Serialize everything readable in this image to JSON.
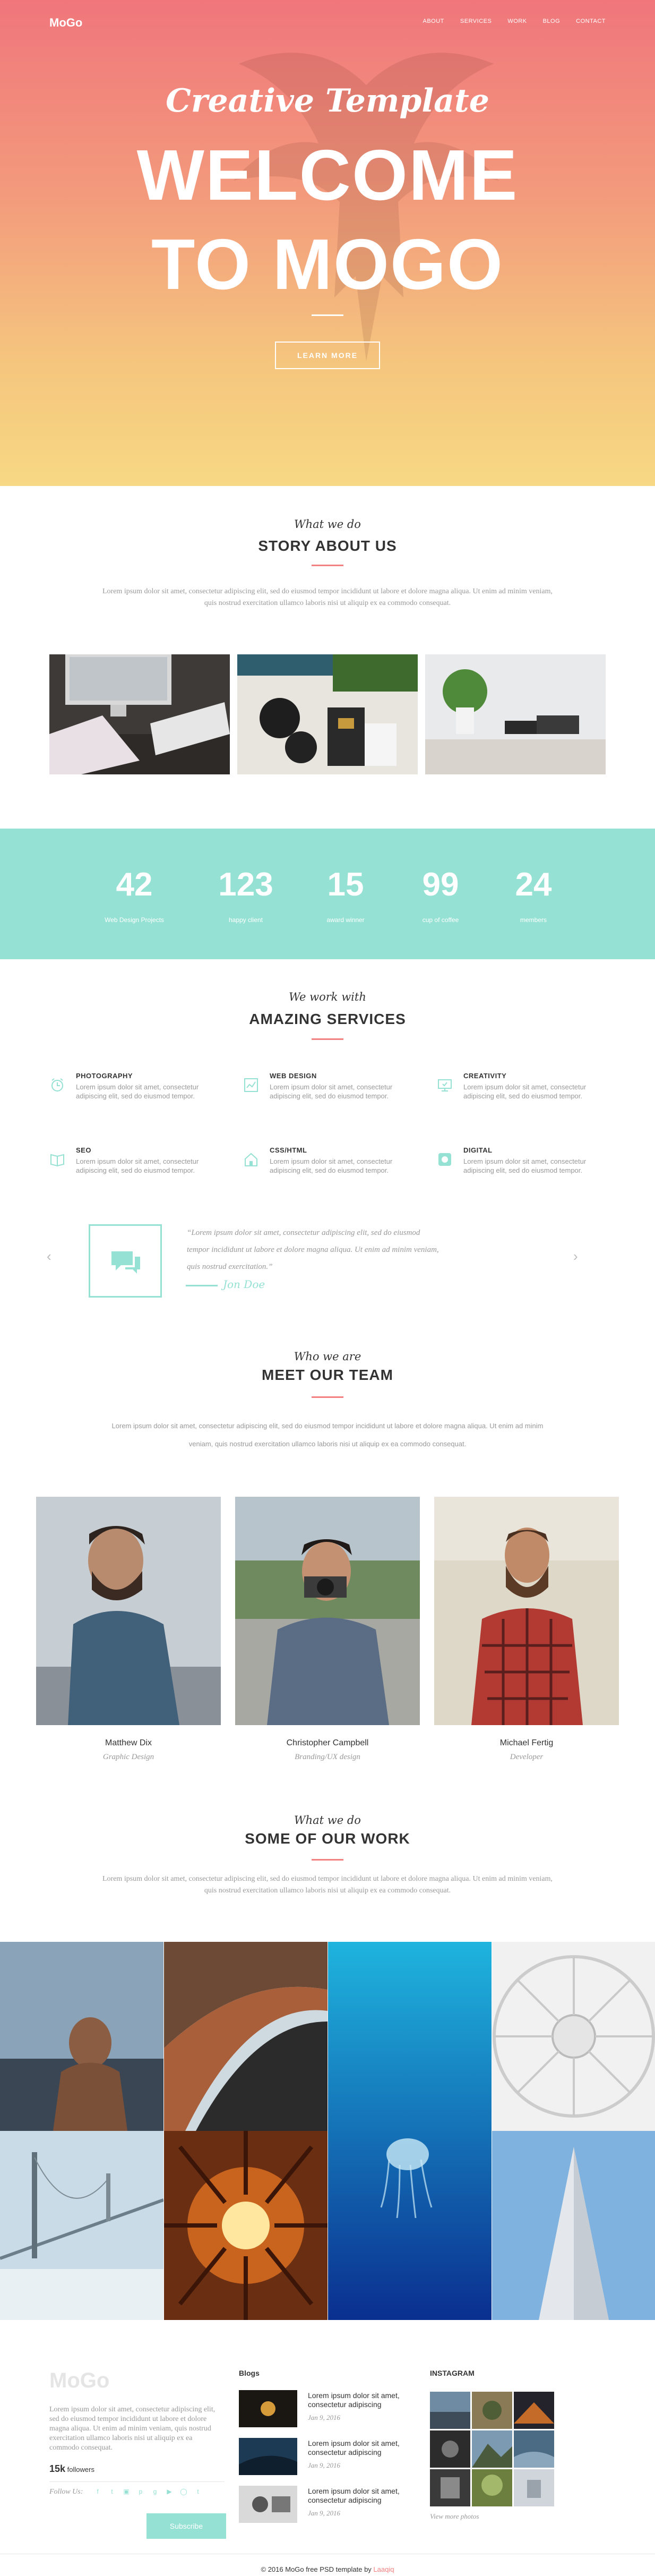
{
  "colors": {
    "accent": "#f38181",
    "mint": "#95e1d3",
    "hero_top": "#f0767c",
    "hero_bottom": "#f7d884"
  },
  "header": {
    "logo": "MoGo",
    "menu": [
      "ABOUT",
      "SERVICES",
      "WORK",
      "BLOG",
      "CONTACT"
    ]
  },
  "hero": {
    "script": "Creative Template",
    "title_line1": "WELCOME",
    "title_line2": "TO MOGO",
    "button": "LEARN MORE"
  },
  "story": {
    "script": "What we do",
    "title": "STORY ABOUT US",
    "text": "Lorem ipsum dolor sit amet, consectetur adipiscing elit, sed do eiusmod tempor incididunt ut labore et dolore magna aliqua. Ut enim ad minim veniam, quis nostrud exercitation ullamco laboris nisi ut aliquip ex ea commodo consequat."
  },
  "stats": [
    {
      "num": "42",
      "label": "Web Design Projects"
    },
    {
      "num": "123",
      "label": "happy client"
    },
    {
      "num": "15",
      "label": "award winner"
    },
    {
      "num": "99",
      "label": "cup of coffee"
    },
    {
      "num": "24",
      "label": "members"
    }
  ],
  "services": {
    "script": "We work with",
    "title": "AMAZING SERVICES",
    "items": [
      {
        "icon": "alarm-clock-icon",
        "title": "PHOTOGRAPHY",
        "desc": "Lorem ipsum dolor sit amet, consectetur adipiscing elit, sed do eiusmod tempor."
      },
      {
        "icon": "chart-icon",
        "title": "WEB DESIGN",
        "desc": "Lorem ipsum dolor sit amet, consectetur adipiscing elit, sed do eiusmod tempor."
      },
      {
        "icon": "monitor-icon",
        "title": "CREATIVITY",
        "desc": "Lorem ipsum dolor sit amet, consectetur adipiscing elit, sed do eiusmod tempor."
      },
      {
        "icon": "book-icon",
        "title": "SEO",
        "desc": "Lorem ipsum dolor sit amet, consectetur adipiscing elit, sed do eiusmod tempor."
      },
      {
        "icon": "house-icon",
        "title": "CSS/HTML",
        "desc": "Lorem ipsum dolor sit amet, consectetur adipiscing elit, sed do eiusmod tempor."
      },
      {
        "icon": "badge-icon",
        "title": "DIGITAL",
        "desc": "Lorem ipsum dolor sit amet, consectetur adipiscing elit, sed do eiusmod tempor."
      }
    ]
  },
  "testimonial": {
    "line1": "“Lorem ipsum dolor sit amet, consectetur adipiscing elit, sed do eiusmod",
    "line2": "tempor incididunt ut labore et dolore magna aliqua. Ut enim ad minim veniam,",
    "line3": "quis nostrud exercitation.”",
    "author": "Jon Doe"
  },
  "team": {
    "script": "Who we are",
    "title": "MEET OUR TEAM",
    "text_line1": "Lorem ipsum dolor sit amet, consectetur adipiscing elit, sed do eiusmod tempor incididunt ut labore et dolore magna aliqua. Ut enim ad minim",
    "text_line2": "veniam, quis nostrud exercitation ullamco laboris nisi ut aliquip ex ea commodo consequat.",
    "members": [
      {
        "name": "Matthew Dix",
        "role": "Graphic Design"
      },
      {
        "name": "Christopher Campbell",
        "role": "Branding/UX design"
      },
      {
        "name": "Michael Fertig ",
        "role": "Developer"
      }
    ]
  },
  "work": {
    "script": "What we do",
    "title": "SOME OF OUR WORK",
    "text": "Lorem ipsum dolor sit amet, consectetur adipiscing elit, sed do eiusmod tempor incididunt ut labore et dolore magna aliqua. Ut enim ad minim veniam, quis nostrud exercitation ullamco laboris nisi ut aliquip ex ea commodo consequat."
  },
  "footer": {
    "logo": "MoGo",
    "about": "Lorem ipsum dolor sit amet, consectetur adipiscing elit, sed do eiusmod tempor incididunt ut labore et dolore magna aliqua. Ut enim ad minim veniam, quis nostrud exercitation ullamco laboris nisi ut aliquip ex ea commodo consequat.",
    "followers_count": "15k",
    "followers_label": "followers",
    "follow_us": "Follow Us:",
    "social_icons": [
      "facebook-icon",
      "twitter-icon",
      "instagram-icon",
      "pinterest-icon",
      "google-plus-icon",
      "youtube-icon",
      "dribbble-icon",
      "tumblr-icon"
    ],
    "subscribe": "Subscribe",
    "blogs_title": "Blogs",
    "blogs": [
      {
        "title": "Lorem ipsum dolor sit amet, consectetur adipiscing",
        "date": "Jan 9, 2016"
      },
      {
        "title": "Lorem ipsum dolor sit amet, consectetur adipiscing",
        "date": "Jan 9, 2016"
      },
      {
        "title": "Lorem ipsum dolor sit amet, consectetur adipiscing",
        "date": "Jan 9, 2016"
      }
    ],
    "instagram_title": "INSTAGRAM",
    "view_more": "View more photos",
    "copyright_pre": "© 2016 MoGo free PSD template by ",
    "copyright_author": "Laaqiq"
  }
}
